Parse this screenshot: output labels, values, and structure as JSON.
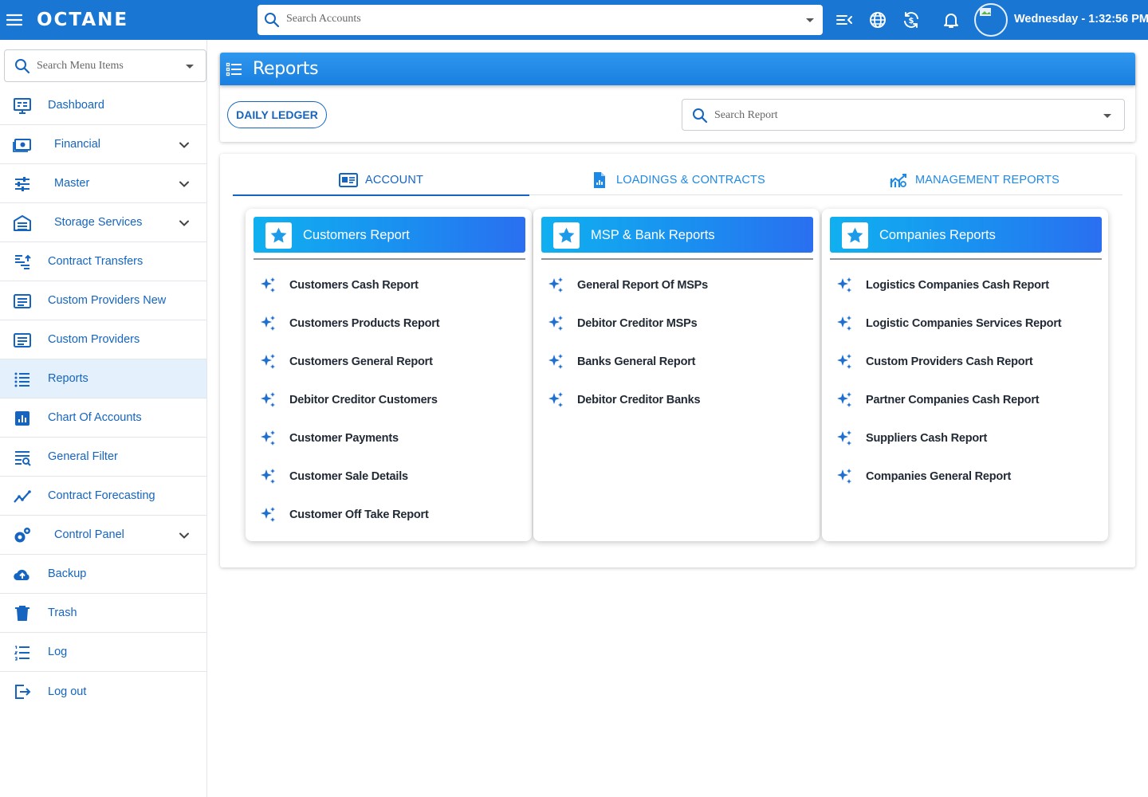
{
  "app": {
    "brand": "OCTANE",
    "account_search_placeholder": "Search Accounts",
    "clock": "Wednesday - 1:32:56 PM",
    "primary_color": "#1976d2"
  },
  "sidebar": {
    "search_placeholder": "Search Menu Items",
    "items": [
      {
        "label": "Dashboard",
        "icon": "monitor-icon"
      },
      {
        "label": "Financial",
        "icon": "money-icon",
        "expandable": true
      },
      {
        "label": "Master",
        "icon": "sliders-icon",
        "expandable": true
      },
      {
        "label": "Storage Services",
        "icon": "warehouse-icon",
        "expandable": true
      },
      {
        "label": "Contract Transfers",
        "icon": "transfer-icon"
      },
      {
        "label": "Custom Providers New",
        "icon": "list-box-icon"
      },
      {
        "label": "Custom Providers",
        "icon": "list-box-icon"
      },
      {
        "label": "Reports",
        "icon": "list-icon",
        "active": true
      },
      {
        "label": "Chart Of Accounts",
        "icon": "chart-icon"
      },
      {
        "label": "General Filter",
        "icon": "filter-search-icon"
      },
      {
        "label": "Contract Forecasting",
        "icon": "trend-icon"
      },
      {
        "label": "Control Panel",
        "icon": "gears-icon",
        "expandable": true
      },
      {
        "label": "Backup",
        "icon": "cloud-upload-icon"
      },
      {
        "label": "Trash",
        "icon": "trash-icon"
      },
      {
        "label": "Log",
        "icon": "numbered-list-icon"
      },
      {
        "label": "Log out",
        "icon": "logout-icon"
      }
    ]
  },
  "header": {
    "title": "Reports",
    "daily_ledger_label": "DAILY LEDGER",
    "report_search_placeholder": "Search Report"
  },
  "tabs": [
    {
      "label": "ACCOUNT",
      "icon": "account-card-icon",
      "active": true
    },
    {
      "label": "LOADINGS & CONTRACTS",
      "icon": "document-chart-icon"
    },
    {
      "label": "MANAGEMENT REPORTS",
      "icon": "management-chart-icon"
    }
  ],
  "cards": [
    {
      "title": "Customers Report",
      "items": [
        "Customers Cash Report",
        "Customers Products Report",
        "Customers General Report",
        "Debitor Creditor Customers",
        "Customer Payments",
        "Customer Sale Details",
        "Customer Off Take Report"
      ]
    },
    {
      "title": "MSP & Bank Reports",
      "items": [
        "General Report Of MSPs",
        "Debitor Creditor MSPs",
        "Banks General Report",
        "Debitor Creditor Banks"
      ]
    },
    {
      "title": "Companies Reports",
      "items": [
        "Logistics Companies Cash Report",
        "Logistic Companies Services Report",
        "Custom Providers Cash Report",
        "Partner Companies Cash Report",
        "Suppliers Cash Report",
        "Companies General Report"
      ]
    }
  ]
}
